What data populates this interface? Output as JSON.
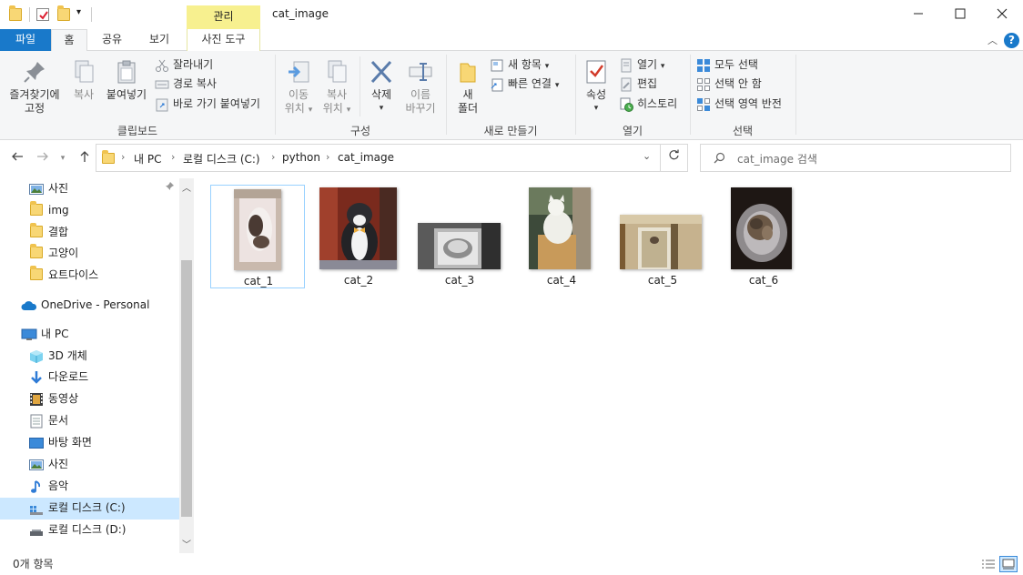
{
  "window": {
    "title": "cat_image",
    "context_tab_header": "관리",
    "minimize": "—",
    "maximize": "☐",
    "close": "✕"
  },
  "ribbon_tabs": {
    "file": "파일",
    "home": "홈",
    "share": "공유",
    "view": "보기",
    "picture_tools": "사진 도구",
    "help": "?"
  },
  "ribbon": {
    "clipboard": {
      "label": "클립보드",
      "pin_line1": "즐겨찾기에",
      "pin_line2": "고정",
      "copy": "복사",
      "paste": "붙여넣기",
      "cut": "잘라내기",
      "copy_path": "경로 복사",
      "paste_shortcut": "바로 가기 붙여넣기"
    },
    "organize": {
      "label": "구성",
      "move_line1": "이동",
      "move_line2": "위치",
      "copy_line1": "복사",
      "copy_line2": "위치",
      "delete": "삭제",
      "rename_line1": "이름",
      "rename_line2": "바꾸기"
    },
    "new": {
      "label": "새로 만들기",
      "new_folder_line1": "새",
      "new_folder_line2": "폴더",
      "new_item": "새 항목",
      "easy_access": "빠른 연결"
    },
    "open": {
      "label": "열기",
      "properties": "속성",
      "open": "열기",
      "edit": "편집",
      "history": "히스토리"
    },
    "select": {
      "label": "선택",
      "select_all": "모두 선택",
      "select_none": "선택 안 함",
      "invert": "선택 영역 반전"
    }
  },
  "address": {
    "crumbs": [
      "내 PC",
      "로컬 디스크 (C:)",
      "python",
      "cat_image"
    ],
    "search_placeholder": "cat_image 검색"
  },
  "nav_pane": {
    "quick_access": [
      {
        "label": "사진",
        "icon": "pictures-icon"
      },
      {
        "label": "img",
        "icon": "folder-icon"
      },
      {
        "label": "결합",
        "icon": "folder-icon"
      },
      {
        "label": "고양이",
        "icon": "folder-icon"
      },
      {
        "label": "요트다이스",
        "icon": "folder-icon"
      }
    ],
    "onedrive": "OneDrive - Personal",
    "this_pc": "내 PC",
    "pc_items": [
      {
        "label": "3D 개체",
        "icon": "3d-objects-icon"
      },
      {
        "label": "다운로드",
        "icon": "downloads-icon"
      },
      {
        "label": "동영상",
        "icon": "videos-icon"
      },
      {
        "label": "문서",
        "icon": "documents-icon"
      },
      {
        "label": "바탕 화면",
        "icon": "desktop-icon"
      },
      {
        "label": "사진",
        "icon": "pictures-icon"
      },
      {
        "label": "음악",
        "icon": "music-icon"
      },
      {
        "label": "로컬 디스크 (C:)",
        "icon": "drive-c-icon"
      },
      {
        "label": "로컬 디스크 (D:)",
        "icon": "drive-d-icon"
      }
    ]
  },
  "files": [
    {
      "name": "cat_1",
      "selected": true
    },
    {
      "name": "cat_2",
      "selected": false
    },
    {
      "name": "cat_3",
      "selected": false
    },
    {
      "name": "cat_4",
      "selected": false
    },
    {
      "name": "cat_5",
      "selected": false
    },
    {
      "name": "cat_6",
      "selected": false
    }
  ],
  "status": {
    "item_count": "0개 항목"
  },
  "colors": {
    "accent": "#1979ca",
    "context_tab": "#f7f08f",
    "selection": "#cce8ff",
    "folder": "#f8d775"
  }
}
